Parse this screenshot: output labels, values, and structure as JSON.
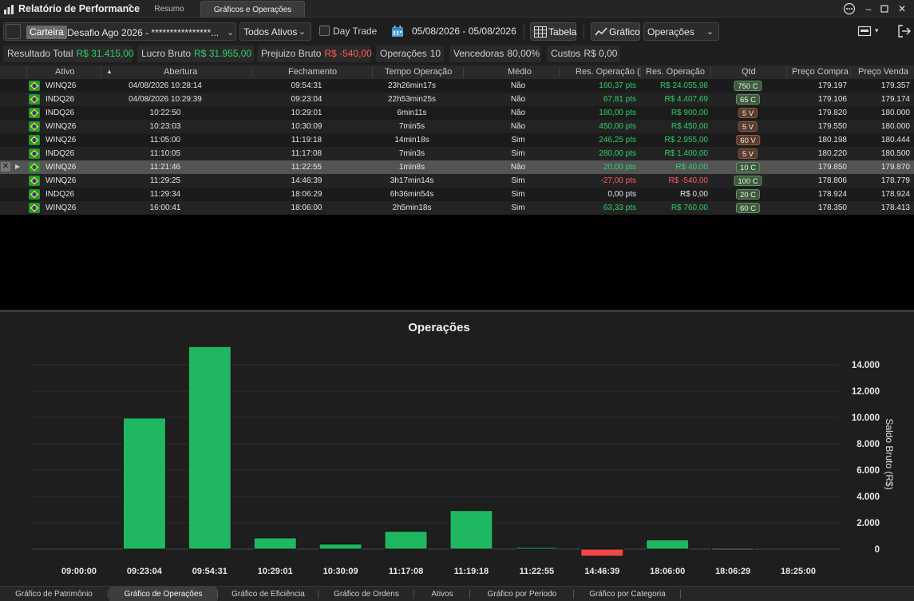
{
  "window": {
    "title": "Relatório de Performance",
    "tabs": [
      "Resumo",
      "Gráficos e Operações"
    ]
  },
  "toolbar": {
    "carteira_label": "Carteira",
    "carteira_value": "Desafio Ago 2026 - ****************...",
    "ativos_select": "Todos Ativos",
    "daytrade_label": "Day Trade",
    "date_range": "05/08/2026 - 05/08/2026",
    "tabela_label": "Tabela",
    "grafico_label": "Gráfico",
    "operacoes_select": "Operações"
  },
  "stats": {
    "resultado_total_label": "Resultado Total",
    "resultado_total_value": "R$ 31.415,00",
    "lucro_bruto_label": "Lucro Bruto",
    "lucro_bruto_value": "R$ 31.955,00",
    "prejuizo_bruto_label": "Prejuizo Bruto",
    "prejuizo_bruto_value": "R$ -540,00",
    "operacoes_label": "Operações",
    "operacoes_value": "10",
    "vencedoras_label": "Vencedoras",
    "vencedoras_value": "80,00%",
    "custos_label": "Custos",
    "custos_value": "R$ 0,00"
  },
  "table": {
    "headers": [
      "Ativo",
      "Abertura",
      "Fechamento",
      "Tempo Operação",
      "Médio",
      "Res. Operação (",
      "Res. Operação",
      "Qtd",
      "Preço Compra",
      "Preço Venda"
    ],
    "rows": [
      {
        "ativo": "WINQ26",
        "abertura": "04/08/2026 10:28:14",
        "fechamento": "09:54:31",
        "tempo": "23h26min17s",
        "medio": "Não",
        "res_pts": "160,37 pts",
        "res_brl": "R$ 24.055,98",
        "qtd": "750 C",
        "compra": "179.197",
        "venda": "179.357",
        "neg": false,
        "side": "c"
      },
      {
        "ativo": "INDQ26",
        "abertura": "04/08/2026 10:29:39",
        "fechamento": "09:23:04",
        "tempo": "22h53min25s",
        "medio": "Não",
        "res_pts": "67,81 pts",
        "res_brl": "R$ 4.407,69",
        "qtd": "65 C",
        "compra": "179.106",
        "venda": "179.174",
        "neg": false,
        "side": "c"
      },
      {
        "ativo": "INDQ26",
        "abertura": "10:22:50",
        "fechamento": "10:29:01",
        "tempo": "6min11s",
        "medio": "Não",
        "res_pts": "180,00 pts",
        "res_brl": "R$ 900,00",
        "qtd": "5 V",
        "compra": "179.820",
        "venda": "180.000",
        "neg": false,
        "side": "v"
      },
      {
        "ativo": "WINQ26",
        "abertura": "10:23:03",
        "fechamento": "10:30:09",
        "tempo": "7min5s",
        "medio": "Não",
        "res_pts": "450,00 pts",
        "res_brl": "R$ 450,00",
        "qtd": "5 V",
        "compra": "179.550",
        "venda": "180.000",
        "neg": false,
        "side": "v"
      },
      {
        "ativo": "WINQ26",
        "abertura": "11:05:00",
        "fechamento": "11:19:18",
        "tempo": "14min18s",
        "medio": "Sim",
        "res_pts": "246,25 pts",
        "res_brl": "R$ 2.955,00",
        "qtd": "60 V",
        "compra": "180.198",
        "venda": "180.444",
        "neg": false,
        "side": "v"
      },
      {
        "ativo": "INDQ26",
        "abertura": "11:10:05",
        "fechamento": "11:17:08",
        "tempo": "7min3s",
        "medio": "Sim",
        "res_pts": "280,00 pts",
        "res_brl": "R$ 1.400,00",
        "qtd": "5 V",
        "compra": "180.220",
        "venda": "180.500",
        "neg": false,
        "side": "v"
      },
      {
        "ativo": "WINQ26",
        "abertura": "11:21:46",
        "fechamento": "11:22:55",
        "tempo": "1min8s",
        "medio": "Não",
        "res_pts": "20,00 pts",
        "res_brl": "R$ 40,00",
        "qtd": "10 C",
        "compra": "179.850",
        "venda": "179.870",
        "neg": false,
        "side": "c"
      },
      {
        "ativo": "WINQ26",
        "abertura": "11:29:25",
        "fechamento": "14:46:39",
        "tempo": "3h17min14s",
        "medio": "Sim",
        "res_pts": "-27,00 pts",
        "res_brl": "R$ -540,00",
        "qtd": "100 C",
        "compra": "178.806",
        "venda": "178.779",
        "neg": true,
        "side": "c"
      },
      {
        "ativo": "INDQ26",
        "abertura": "11:29:34",
        "fechamento": "18:06:29",
        "tempo": "6h36min54s",
        "medio": "Sim",
        "res_pts": "0,00 pts",
        "res_brl": "R$ 0,00",
        "qtd": "20 C",
        "compra": "178.924",
        "venda": "178.924",
        "neg": false,
        "zero": true,
        "side": "c"
      },
      {
        "ativo": "WINQ26",
        "abertura": "16:00:41",
        "fechamento": "18:06:00",
        "tempo": "2h5min18s",
        "medio": "Sim",
        "res_pts": "63,33 pts",
        "res_brl": "R$ 760,00",
        "qtd": "60 C",
        "compra": "178.350",
        "venda": "178.413",
        "neg": false,
        "side": "c"
      }
    ]
  },
  "chart_data": {
    "type": "bar",
    "title": "Operações",
    "ylabel": "Saldo Bruto (R$)",
    "xlabel": "",
    "categories": [
      "09:00:00",
      "09:23:04",
      "09:54:31",
      "10:29:01",
      "10:30:09",
      "11:17:08",
      "11:19:18",
      "11:22:55",
      "14:46:39",
      "18:06:00",
      "18:06:29",
      "18:25:00"
    ],
    "values": [
      null,
      9950,
      15380,
      850,
      380,
      1350,
      2930,
      60,
      -540,
      700,
      0,
      null
    ],
    "ylim": [
      -800,
      15300
    ],
    "yticks": [
      0,
      2000,
      4000,
      6000,
      8000,
      10000,
      12000,
      14000
    ],
    "ytick_labels": [
      "0",
      "2.000",
      "4.000",
      "6.000",
      "8.000",
      "10.000",
      "12.000",
      "14.000"
    ],
    "grid": true,
    "colors": {
      "positive": "#1fb860",
      "negative": "#f04848",
      "zero": "#7a7a7a"
    }
  },
  "bottom_tabs": [
    "Gráfico de Patrimônio",
    "Gráfico de Operações",
    "Gráfico de Eficiência",
    "Gráfico de Ordens",
    "Ativos",
    "Gráfico por Periodo",
    "Gráfico por Categoria"
  ],
  "colors": {
    "accent_green": "#2ed06a",
    "accent_red": "#ff5b5b"
  }
}
